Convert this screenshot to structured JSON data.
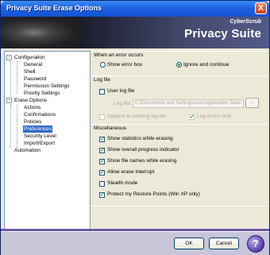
{
  "window": {
    "title": "Privacy Suite Erase Options",
    "close_glyph": "X"
  },
  "banner": {
    "brand": "CyberScrub",
    "product": "Privacy Suite"
  },
  "tree": {
    "items": [
      {
        "label": "Configuration",
        "expander": "-"
      },
      {
        "label": "General"
      },
      {
        "label": "Shell"
      },
      {
        "label": "Password"
      },
      {
        "label": "Permission Settings"
      },
      {
        "label": "Priority Settings"
      },
      {
        "label": "Erase Options",
        "expander": "-"
      },
      {
        "label": "Actions"
      },
      {
        "label": "Confirmations"
      },
      {
        "label": "Policies"
      },
      {
        "label": "Preferences"
      },
      {
        "label": "Security Level"
      },
      {
        "label": "Import/Export"
      },
      {
        "label": "Automation"
      }
    ]
  },
  "error_group": {
    "title": "When an error occurs",
    "show_error_box": "Show error box",
    "ignore_and_continue": "Ignore and continue",
    "selected": "Ignore and continue"
  },
  "log_group": {
    "title": "Log file",
    "user_log_file": "User log file",
    "log_file_label": "Log file:",
    "log_file_value": "C:\\Documents and Settings\\user\\Application Data\\",
    "browse_label": "...",
    "append_label": "Append to existing log file",
    "errors_only_label": "Log errors only"
  },
  "misc_group": {
    "title": "Miscellaneous",
    "options": [
      {
        "label": "Show statistics while erasing",
        "checked": true
      },
      {
        "label": "Show overall progress indicator",
        "checked": true
      },
      {
        "label": "Show file names while erasing",
        "checked": true
      },
      {
        "label": "Allow erase interrupt",
        "checked": true
      },
      {
        "label": "Stealth mode",
        "checked": false
      },
      {
        "label": "Protect my Restore Points (Win XP only)",
        "checked": true
      }
    ]
  },
  "buttons": {
    "ok": "OK",
    "cancel": "Cancel",
    "help": "?"
  },
  "colors": {
    "title_bar": "#1f62e0",
    "selection": "#316ac5",
    "check_mark": "#21a121",
    "bottom_stripe": "#6a5aa0"
  }
}
